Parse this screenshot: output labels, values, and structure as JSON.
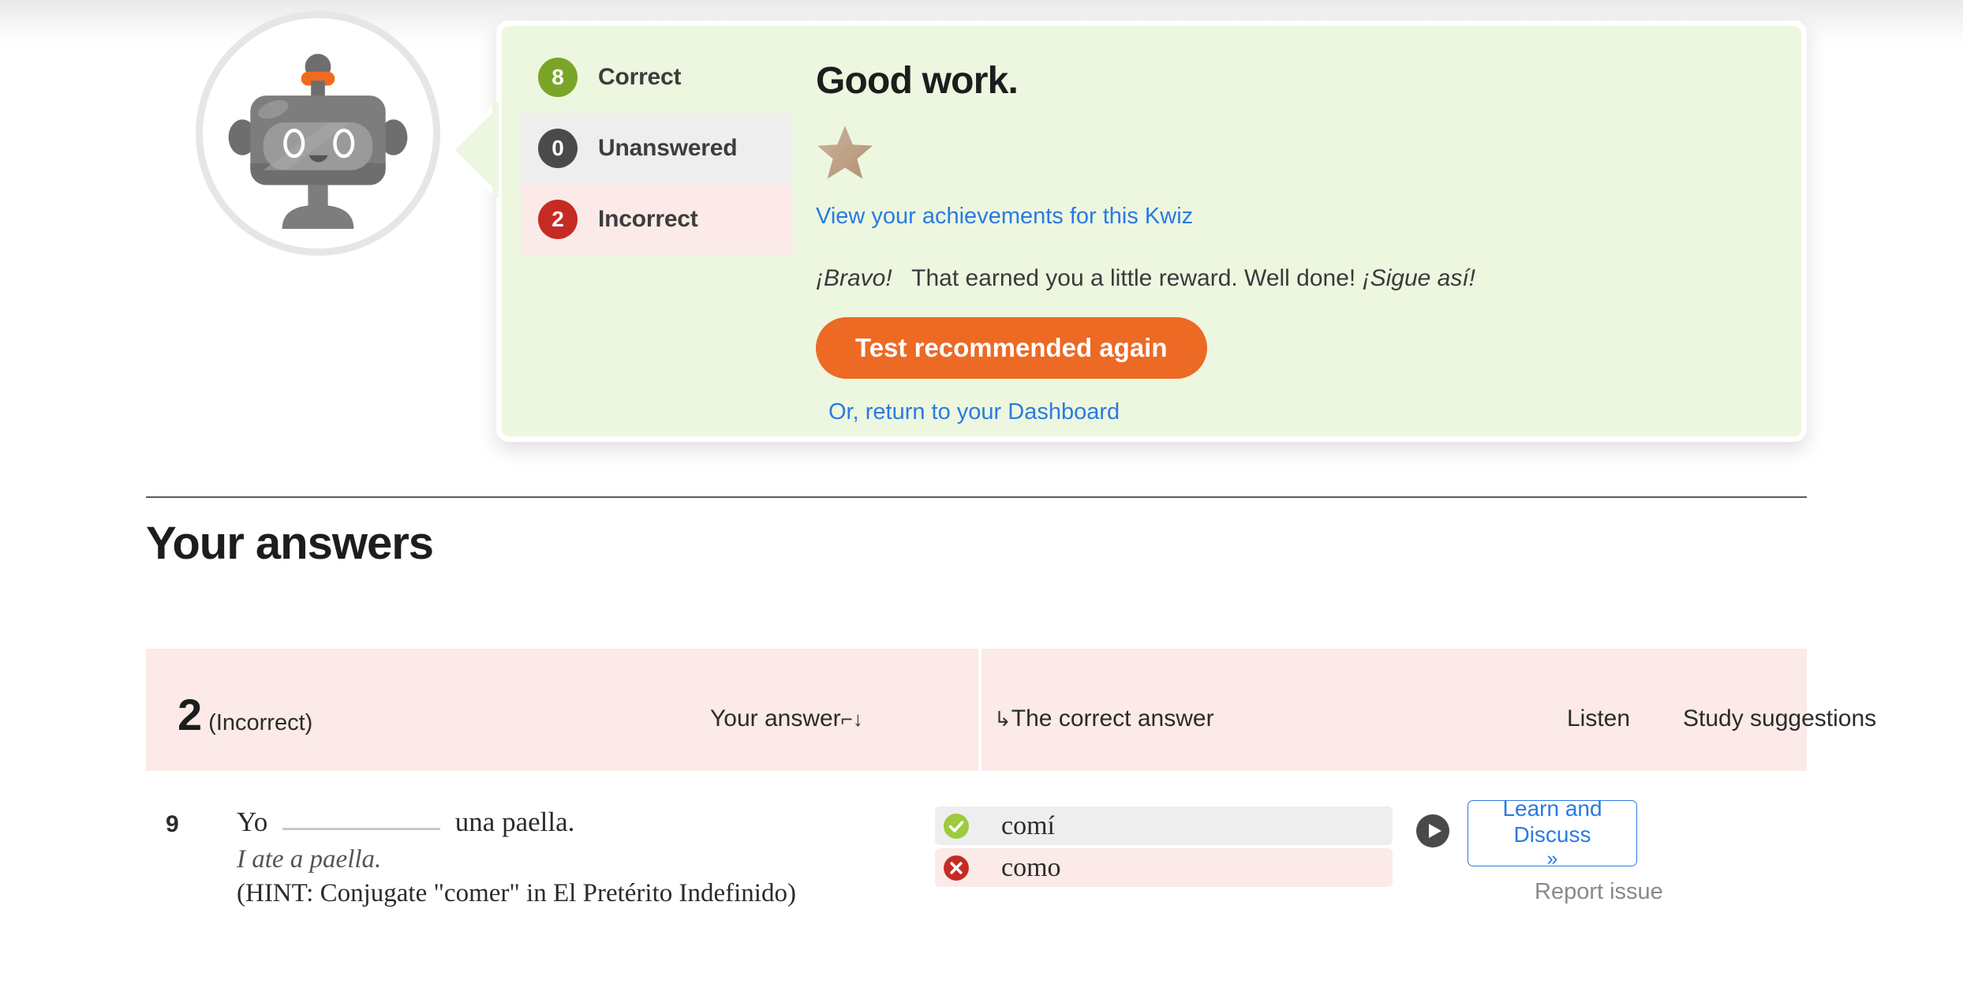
{
  "colors": {
    "green_panel": "#edf7e0",
    "pink_row": "#fbeae7",
    "gray_row": "#eeeeee",
    "accent_orange": "#ec6a24",
    "link_blue": "#2a7ae2",
    "correct_green": "#7ba528",
    "incorrect_red": "#c62b23",
    "star_tan": "#c4a88d"
  },
  "avatar": {
    "icon": "robot-mascot-icon"
  },
  "scores": [
    {
      "count": "8",
      "label": "Correct",
      "state": "correct"
    },
    {
      "count": "0",
      "label": "Unanswered",
      "state": "unanswered"
    },
    {
      "count": "2",
      "label": "Incorrect",
      "state": "incorrect"
    }
  ],
  "result": {
    "heading": "Good work.",
    "star_icon": "star-icon",
    "achievements_link": "View your achievements for this Kwiz",
    "bravo_prefix": "¡Bravo!",
    "bravo_body": "That earned you a little reward. Well done!",
    "bravo_suffix": "¡Sigue así!",
    "cta_label": "Test recommended again",
    "dashboard_link": "Or, return to your Dashboard"
  },
  "answers_section": {
    "title": "Your answers",
    "summary": {
      "count": "2",
      "label": "(Incorrect)"
    },
    "columns": {
      "your_answer": "Your answer",
      "your_answer_arrow": "⌐↓",
      "correct_answer": "The correct answer",
      "correct_answer_arrow": "↳",
      "listen": "Listen",
      "study": "Study suggestions"
    },
    "rows": [
      {
        "number": "9",
        "sentence_before": "Yo",
        "sentence_after": "una paella.",
        "translation": "I ate a paella.",
        "hint": "(HINT: Conjugate \"comer\" in El Pretérito Indefinido)",
        "correct_answer": "comí",
        "user_answer": "como",
        "listen_icon": "play-icon",
        "study_label": "Learn and Discuss",
        "study_chevron": "»",
        "report_label": "Report issue"
      }
    ]
  }
}
